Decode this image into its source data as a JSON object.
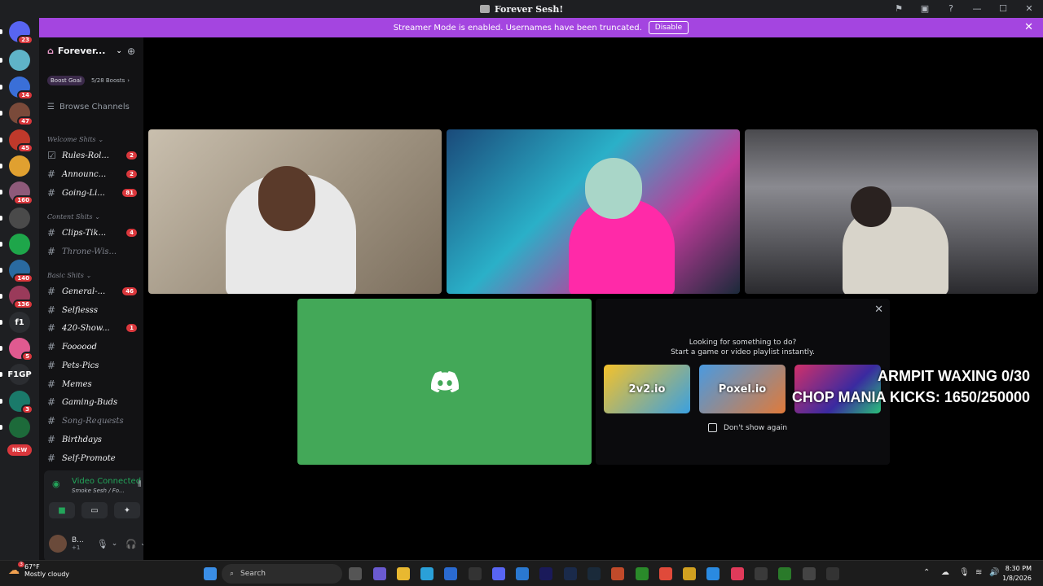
{
  "window": {
    "title": "Forever Sesh!"
  },
  "banner": {
    "text": "Streamer Mode is enabled. Usernames have been truncated.",
    "disable_label": "Disable"
  },
  "guilds": [
    {
      "badge": "23",
      "color": "#5865f2"
    },
    {
      "badge": "",
      "color": "#5fb3c8"
    },
    {
      "badge": "14",
      "color": "#3a6fd8"
    },
    {
      "badge": "47",
      "color": "#7a4a3a"
    },
    {
      "badge": "45",
      "color": "#c0392b"
    },
    {
      "badge": "",
      "color": "#e0a030"
    },
    {
      "badge": "160",
      "color": "#8e5a7a"
    },
    {
      "badge": "",
      "color": "#4a4a4a"
    },
    {
      "badge": "",
      "color": "#1ea64a"
    },
    {
      "badge": "140",
      "color": "#2a6aa0"
    },
    {
      "badge": "136",
      "color": "#9a3a5a"
    },
    {
      "badge": "",
      "color": "#2b2d31",
      "text": "f1"
    },
    {
      "badge": "5",
      "color": "#e05a90"
    },
    {
      "badge": "",
      "color": "#2b2d31",
      "text": "F1GP"
    },
    {
      "badge": "3",
      "color": "#1a7a6a"
    },
    {
      "badge": "",
      "color": "#1d6a3a"
    },
    {
      "badge": "NEW",
      "color": "#3a3a3a"
    }
  ],
  "server": {
    "name": "Forever...",
    "boost_goal": "Boost Goal",
    "boosts": "5/28 Boosts",
    "browse": "Browse Channels"
  },
  "categories": {
    "welcome": "Welcome Shits",
    "content": "Content Shits",
    "basic": "Basic Shits"
  },
  "channels": [
    {
      "name": "Rules-Rol...",
      "badge": "2",
      "muted": false,
      "icon": "rules-icon"
    },
    {
      "name": "Announc...",
      "badge": "2",
      "muted": false,
      "icon": "hash-icon"
    },
    {
      "name": "Going-Li...",
      "badge": "81",
      "muted": false,
      "icon": "hash-icon"
    },
    {
      "name": "Clips-Tik...",
      "badge": "4",
      "muted": false,
      "icon": "hash-icon"
    },
    {
      "name": "Throne-Wis...",
      "badge": "",
      "muted": true,
      "icon": "hash-icon"
    },
    {
      "name": "General-...",
      "badge": "46",
      "muted": false,
      "icon": "hash-icon"
    },
    {
      "name": "Selfiesss",
      "badge": "",
      "muted": false,
      "icon": "hash-icon"
    },
    {
      "name": "420-Show...",
      "badge": "1",
      "muted": false,
      "icon": "hash-icon"
    },
    {
      "name": "Foooood",
      "badge": "",
      "muted": false,
      "icon": "hash-icon"
    },
    {
      "name": "Pets-Pics",
      "badge": "",
      "muted": false,
      "icon": "hash-icon"
    },
    {
      "name": "Memes",
      "badge": "",
      "muted": false,
      "icon": "hash-icon"
    },
    {
      "name": "Gaming-Buds",
      "badge": "",
      "muted": false,
      "icon": "hash-icon"
    },
    {
      "name": "Song-Requests",
      "badge": "",
      "muted": true,
      "icon": "hash-icon"
    },
    {
      "name": "Birthdays",
      "badge": "",
      "muted": false,
      "icon": "hash-icon"
    },
    {
      "name": "Self-Promote",
      "badge": "",
      "muted": false,
      "icon": "hash-icon"
    }
  ],
  "voice": {
    "status": "Video Connected",
    "subtitle": "Smoke Sesh / Fo..."
  },
  "user": {
    "name": "B...",
    "sub": "+1"
  },
  "activity": {
    "line1": "Looking for something to do?",
    "line2": "Start a game or video playlist instantly.",
    "games": [
      "2v2.io",
      "Poxel.io",
      ""
    ],
    "dont_show": "Don't show again"
  },
  "overlay": {
    "line1": "ARMPIT WAXING 0/30",
    "line2": "CHOP MANIA KICKS: 1650/250000"
  },
  "taskbar": {
    "temp": "67°F",
    "weather": "Mostly cloudy",
    "weather_badge": "3",
    "search": "Search",
    "time": "8:30 PM",
    "date": "1/8/2026"
  }
}
